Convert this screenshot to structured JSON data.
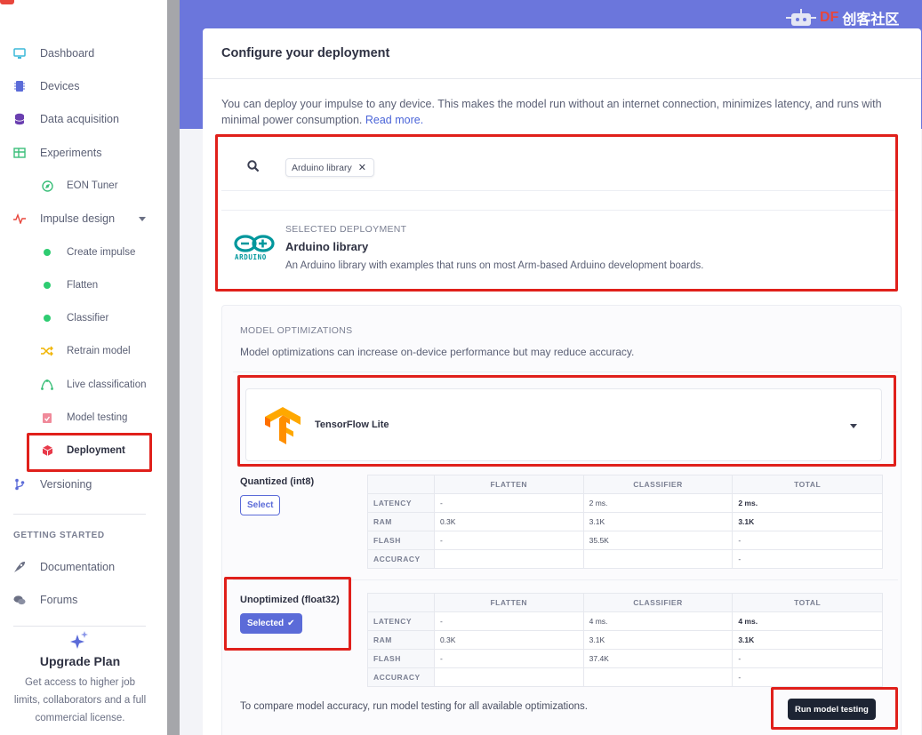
{
  "sidebar": {
    "items": [
      {
        "label": "Dashboard",
        "icon": "monitor-icon"
      },
      {
        "label": "Devices",
        "icon": "chip-icon"
      },
      {
        "label": "Data acquisition",
        "icon": "database-icon"
      },
      {
        "label": "Experiments",
        "icon": "table-icon"
      },
      {
        "label": "EON Tuner",
        "icon": "compass-icon"
      },
      {
        "label": "Impulse design",
        "icon": "pulse-icon"
      },
      {
        "label": "Create impulse",
        "icon": "green-dot-icon"
      },
      {
        "label": "Flatten",
        "icon": "green-dot-icon"
      },
      {
        "label": "Classifier",
        "icon": "green-dot-icon"
      },
      {
        "label": "Retrain model",
        "icon": "shuffle-icon"
      },
      {
        "label": "Live classification",
        "icon": "live-icon"
      },
      {
        "label": "Model testing",
        "icon": "clipboard-check-icon"
      },
      {
        "label": "Deployment",
        "icon": "cube-icon"
      },
      {
        "label": "Versioning",
        "icon": "branch-icon"
      }
    ],
    "getting_started_label": "GETTING STARTED",
    "help_items": [
      {
        "label": "Documentation",
        "icon": "rocket-icon"
      },
      {
        "label": "Forums",
        "icon": "chat-icon"
      }
    ],
    "upgrade": {
      "title": "Upgrade Plan",
      "desc": "Get access to higher job limits, collaborators and a full commercial license."
    }
  },
  "watermark": {
    "prefix": "DF",
    "text": "创客社区"
  },
  "card": {
    "title": "Configure your deployment",
    "intro": "You can deploy your impulse to any device. This makes the model run without an internet connection, minimizes latency, and runs with minimal power consumption. ",
    "read_more": "Read more."
  },
  "search": {
    "chip_label": "Arduino library"
  },
  "selected_deployment": {
    "label": "SELECTED DEPLOYMENT",
    "name": "Arduino library",
    "desc": "An Arduino library with examples that runs on most Arm-based Arduino development boards.",
    "logo_text": "ARDUINO"
  },
  "optimizations": {
    "label": "MODEL OPTIMIZATIONS",
    "desc": "Model optimizations can increase on-device performance but may reduce accuracy.",
    "engine": "TensorFlow Lite",
    "columns": [
      "FLATTEN",
      "CLASSIFIER",
      "TOTAL"
    ],
    "quantized": {
      "title": "Quantized (int8)",
      "button": "Select",
      "rows": [
        {
          "name": "LATENCY",
          "flatten": "-",
          "classifier": "2 ms.",
          "total": "2 ms."
        },
        {
          "name": "RAM",
          "flatten": "0.3K",
          "classifier": "3.1K",
          "total": "3.1K"
        },
        {
          "name": "FLASH",
          "flatten": "-",
          "classifier": "35.5K",
          "total": "-"
        },
        {
          "name": "ACCURACY",
          "flatten": "",
          "classifier": "",
          "total": "-"
        }
      ]
    },
    "unoptimized": {
      "title": "Unoptimized (float32)",
      "button": "Selected",
      "rows": [
        {
          "name": "LATENCY",
          "flatten": "-",
          "classifier": "4 ms.",
          "total": "4 ms."
        },
        {
          "name": "RAM",
          "flatten": "0.3K",
          "classifier": "3.1K",
          "total": "3.1K"
        },
        {
          "name": "FLASH",
          "flatten": "-",
          "classifier": "37.4K",
          "total": "-"
        },
        {
          "name": "ACCURACY",
          "flatten": "",
          "classifier": "",
          "total": "-"
        }
      ]
    },
    "compare_text": "To compare model accuracy, run model testing for all available optimizations.",
    "run_button": "Run model testing"
  },
  "colors": {
    "accent": "#5b6bd8",
    "highlight_box": "#e0201b",
    "header_band": "#6b76dc"
  }
}
